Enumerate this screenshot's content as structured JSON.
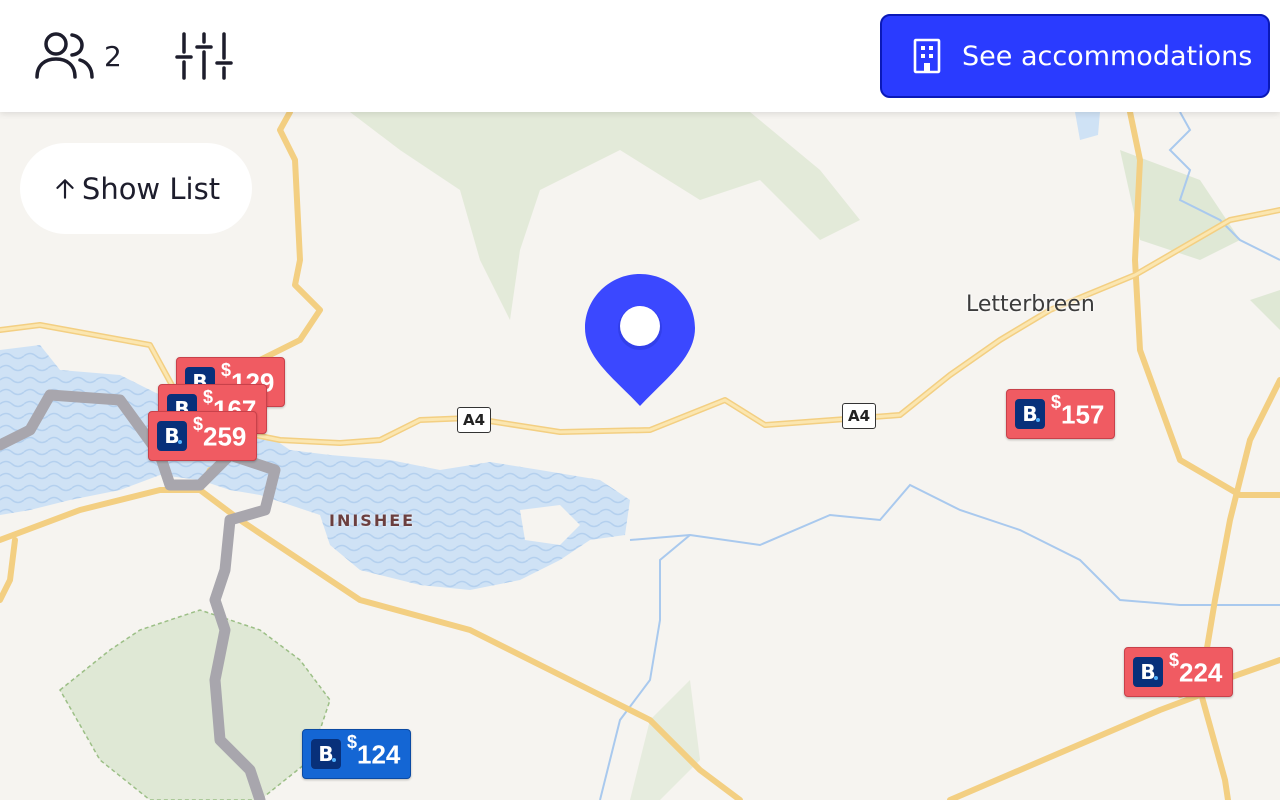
{
  "header": {
    "guests_count": "2",
    "see_button_label": "See accommodations"
  },
  "show_list_label": "Show List",
  "map": {
    "places": [
      {
        "name": "Letterbreen"
      }
    ],
    "islands": [
      {
        "name": "INISHEE"
      }
    ],
    "road_shields": [
      {
        "label": "A4"
      },
      {
        "label": "A4"
      }
    ],
    "colors": {
      "land": "#f6f4f0",
      "water": "#cfe2f5",
      "park": "#dfe8d5",
      "road": "#f8d890",
      "major_route": "#a8a6ad",
      "selected_pin": "#3b48ff",
      "marker_red": "#f05b62",
      "marker_blue": "#1466d4"
    }
  },
  "markers": [
    {
      "logo": "B",
      "currency": "$",
      "amount": "129",
      "color": "red"
    },
    {
      "logo": "B",
      "currency": "$",
      "amount": "167",
      "color": "red"
    },
    {
      "logo": "B",
      "currency": "$",
      "amount": "259",
      "color": "red"
    },
    {
      "logo": "B",
      "currency": "$",
      "amount": "157",
      "color": "red"
    },
    {
      "logo": "B",
      "currency": "$",
      "amount": "224",
      "color": "red"
    },
    {
      "logo": "B",
      "currency": "$",
      "amount": "124",
      "color": "blue"
    }
  ],
  "icons": {
    "guests": "users-icon",
    "filters": "sliders-icon",
    "accommodations": "building-icon",
    "show_list": "arrow-up-icon",
    "location": "map-pin-icon"
  }
}
